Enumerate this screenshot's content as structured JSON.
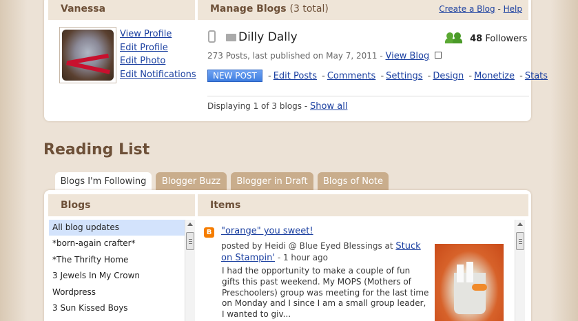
{
  "profile": {
    "name": "Vanessa",
    "links": [
      "View Profile",
      "Edit Profile",
      "Edit Photo",
      "Edit Notifications"
    ]
  },
  "manage": {
    "title": "Manage Blogs",
    "count": "(3 total)",
    "create_link": "Create a Blog",
    "separator": "-",
    "help_link": "Help",
    "blog": {
      "title": "Dilly Dally",
      "followers_count": "48",
      "followers_label": "Followers",
      "meta": "273 Posts, last published on May 7, 2011 -",
      "view_blog": "View Blog",
      "new_post": "NEW POST",
      "actions": [
        "Edit Posts",
        "Comments",
        "Settings",
        "Design",
        "Monetize",
        "Stats"
      ]
    },
    "displaying": "Displaying 1 of 3 blogs -",
    "show_all": "Show all"
  },
  "reading": {
    "title": "Reading List",
    "tabs": [
      "Blogs I'm Following",
      "Blogger Buzz",
      "Blogger in Draft",
      "Blogs of Note"
    ],
    "blogs_header": "Blogs",
    "items_header": "Items",
    "blogs": [
      "All blog updates",
      "*born-again crafter*",
      "*The Thrifty Home",
      "3 Jewels In My Crown",
      "Wordpress",
      "3 Sun Kissed Boys"
    ],
    "item": {
      "title": "\"orange\" you sweet!",
      "by_prefix": "posted by Heidi @ Blue Eyed Blessings at",
      "source": "Stuck on Stampin'",
      "time": "- 1 hour ago",
      "body": "I had the opportunity to make a couple of fun gifts this past weekend. My MOPS (Mothers of Preschoolers) group was meeting for the last time on Monday and I since I am a small group leader, I wanted to giv..."
    }
  },
  "colors": {
    "header_bg": "#efe5d8",
    "header_text": "#6d5038",
    "link": "#1a3fa0",
    "tab_inactive": "#c9ad8c",
    "new_post": "#3f7ee0",
    "followers_icon": "#5aa832",
    "blogger_icon": "#f57d00"
  },
  "icons": [
    "mobile-phone-icon",
    "mail-icon",
    "followers-icon",
    "external-link-icon",
    "blogger-icon"
  ]
}
